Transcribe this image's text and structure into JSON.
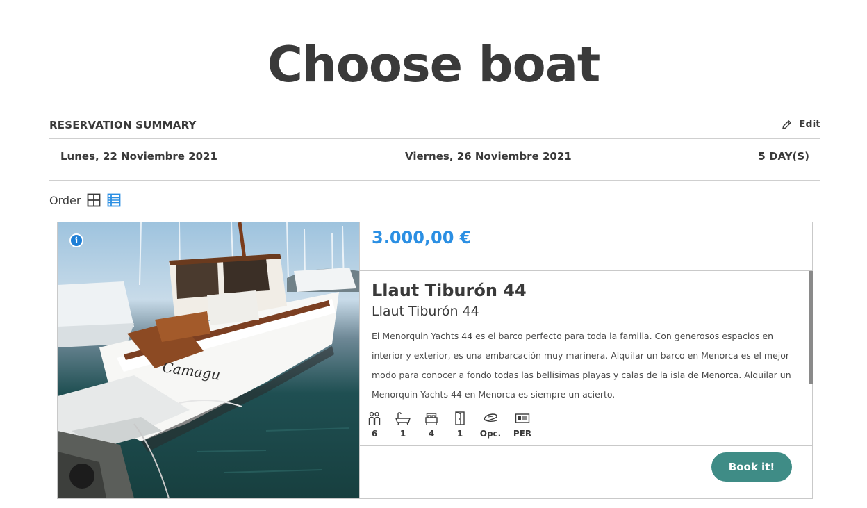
{
  "page": {
    "title": "Choose boat"
  },
  "summary": {
    "title": "RESERVATION SUMMARY",
    "edit_label": "Edit",
    "start_date": "Lunes, 22 Noviembre 2021",
    "end_date": "Viernes, 26 Noviembre 2021",
    "duration": "5 DAY(S)"
  },
  "toolbar": {
    "order_label": "Order",
    "views": [
      {
        "icon": "grid-view-icon",
        "active": false
      },
      {
        "icon": "list-view-icon",
        "active": true
      }
    ]
  },
  "boat": {
    "price": "3.000,00 €",
    "name": "Llaut Tiburón 44",
    "model": "Llaut Tiburón 44",
    "description": "El Menorquin Yachts 44 es el barco perfecto para toda la familia. Con generosos espacios en interior y exterior, es una embarcación muy marinera. Alquilar un barco en Menorca es el mejor modo para conocer a fondo todas las bellísimas playas y calas de la isla de Menorca. Alquilar un Menorquin Yachts 44 en Menorca es siempre un acierto.",
    "hull_name": "Camagu",
    "specs": [
      {
        "icon": "people-icon",
        "value": "6"
      },
      {
        "icon": "bathtub-icon",
        "value": "1"
      },
      {
        "icon": "bed-icon",
        "value": "4"
      },
      {
        "icon": "door-icon",
        "value": "1"
      },
      {
        "icon": "captain-hat-icon",
        "value": "Opc."
      },
      {
        "icon": "license-icon",
        "value": "PER"
      }
    ],
    "book_label": "Book it!"
  },
  "colors": {
    "price": "#2b8fe3",
    "button": "#3f8c86",
    "active_view": "#2b8fe3",
    "text": "#3a3a3a"
  }
}
